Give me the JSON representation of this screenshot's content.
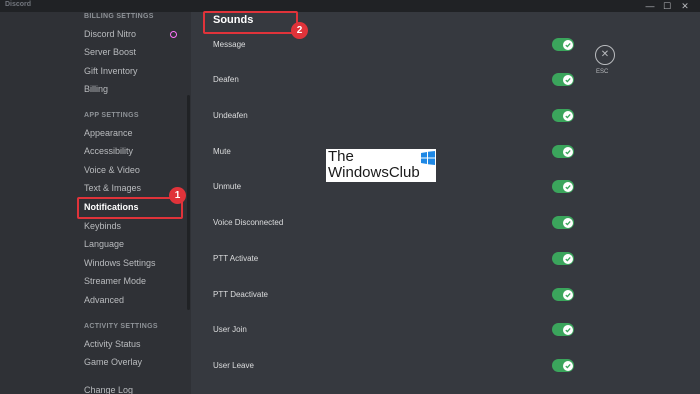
{
  "window": {
    "title": "Discord",
    "controls": [
      "—",
      "☐",
      "✕"
    ]
  },
  "sidebar": {
    "billing_header": "BILLING SETTINGS",
    "billing_items": [
      "Discord Nitro",
      "Server Boost",
      "Gift Inventory",
      "Billing"
    ],
    "app_header": "APP SETTINGS",
    "app_items": [
      "Appearance",
      "Accessibility",
      "Voice & Video",
      "Text & Images",
      "Notifications",
      "Keybinds",
      "Language",
      "Windows Settings",
      "Streamer Mode",
      "Advanced"
    ],
    "activity_header": "ACTIVITY SETTINGS",
    "activity_items": [
      "Activity Status",
      "Game Overlay"
    ],
    "changelog": "Change Log"
  },
  "main": {
    "section_title": "Sounds",
    "sounds": [
      {
        "label": "Message",
        "enabled": true
      },
      {
        "label": "Deafen",
        "enabled": true
      },
      {
        "label": "Undeafen",
        "enabled": true
      },
      {
        "label": "Mute",
        "enabled": true
      },
      {
        "label": "Unmute",
        "enabled": true
      },
      {
        "label": "Voice Disconnected",
        "enabled": true
      },
      {
        "label": "PTT Activate",
        "enabled": true
      },
      {
        "label": "PTT Deactivate",
        "enabled": true
      },
      {
        "label": "User Join",
        "enabled": true
      },
      {
        "label": "User Leave",
        "enabled": true
      }
    ],
    "close_icon": "✕",
    "esc_label": "ESC"
  },
  "annotations": {
    "badge1": "1",
    "badge2": "2",
    "color": "#e0333a"
  },
  "watermark": {
    "line1": "The",
    "line2": "WindowsClub"
  },
  "colors": {
    "toggle_on": "#3ba55c",
    "sidebar_bg": "#2f3136",
    "main_bg": "#36393f"
  }
}
